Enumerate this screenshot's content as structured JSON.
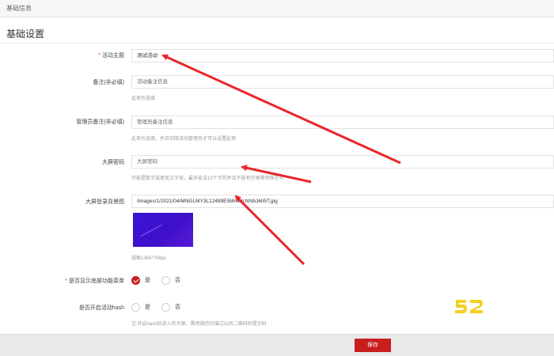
{
  "breadcrumb": "基础信息",
  "section_title": "基础设置",
  "fields": {
    "activity_name": {
      "label": "活动主题",
      "required": true,
      "value": "测试活动"
    },
    "remark": {
      "label": "备注(非必填)",
      "placeholder": "活动备注信息",
      "hint": "此项为选填"
    },
    "admin_remark": {
      "label": "管理员备注(非必填)",
      "placeholder": "管理员备注信息",
      "hint": "此项为选填，并且仅限活动管理员才可以设置此项"
    },
    "screen_password": {
      "label": "大屏密码",
      "placeholder": "大屏密码",
      "hint": "只能是数字或者英文字母，最多能设10个字符并且不能有空格等特殊符号"
    },
    "screen_bg": {
      "label": "大屏登录背景图",
      "value": "/images/1/2021/04/MNGLMY3L12489E5Mmbtr.NNbJ6II5T.jpg",
      "size_hint": "规格1366*768px"
    },
    "show_menu": {
      "label": "是否显示底部功能菜单",
      "required": true,
      "options": [
        "是",
        "否"
      ],
      "selected": "是"
    },
    "enable_hash": {
      "label": "是否开启活动hash",
      "options": [
        "是",
        "否"
      ],
      "selected": "",
      "hint": "注:开启hash后进入的大屏，需用微信扫描过以后二维码的提示码"
    }
  },
  "save_label": "保存",
  "watermark": "52",
  "colors": {
    "primary": "#c81e1e",
    "arrow": "#e8262b",
    "watermark": "#f5d020"
  }
}
